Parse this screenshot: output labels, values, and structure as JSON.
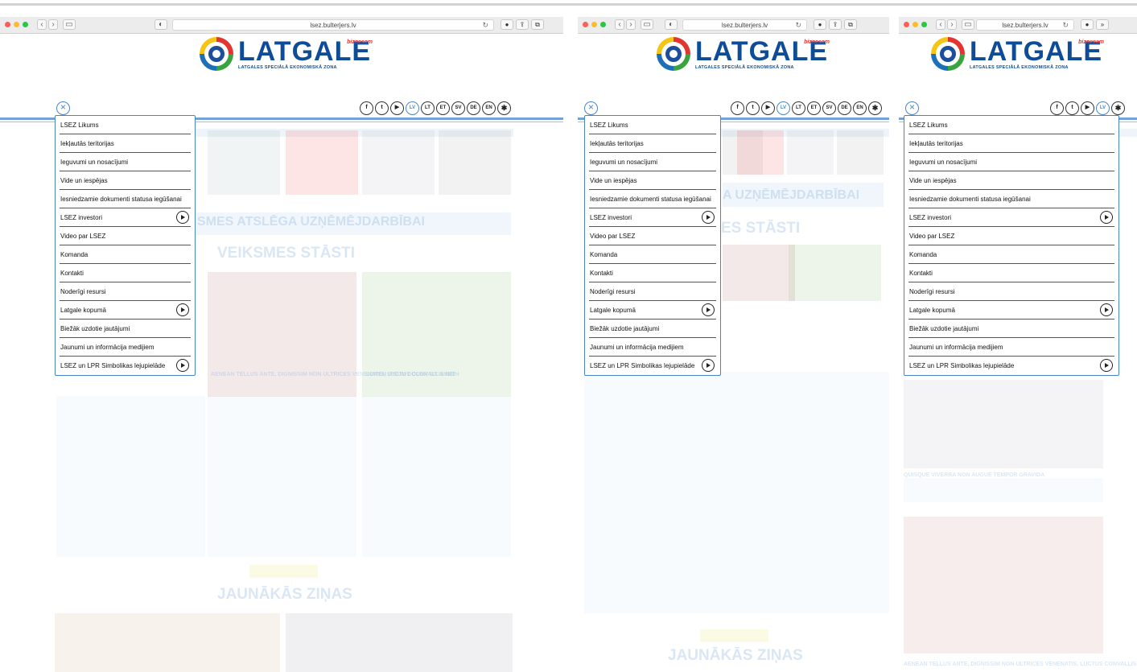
{
  "url": "lsez.bulterjers.lv",
  "logo": {
    "word": "LATGALE",
    "subtitle": "LATGALES SPECIĀLĀ EKONOMISKĀ ZONA",
    "tag": "biznesam"
  },
  "socials": [
    "f",
    "t",
    "▶"
  ],
  "languages": [
    "LV",
    "LT",
    "ET",
    "SV",
    "DE",
    "EN"
  ],
  "active_language": "LV",
  "menu": [
    {
      "label": "LSEZ Likums",
      "arrow": false
    },
    {
      "label": "Iekļautās teritorijas",
      "arrow": false
    },
    {
      "label": "Ieguvumi un nosacījumi",
      "arrow": false
    },
    {
      "label": "Vide un iespējas",
      "arrow": false
    },
    {
      "label": "Iesniedzamie dokumenti statusa iegūšanai",
      "arrow": false
    },
    {
      "label": "LSEZ investori",
      "arrow": true
    },
    {
      "label": "Video par LSEZ",
      "arrow": false
    },
    {
      "label": "Komanda",
      "arrow": false
    },
    {
      "label": "Kontakti",
      "arrow": false
    },
    {
      "label": "Noderīgi resursi",
      "arrow": false
    },
    {
      "label": "Latgale kopumā",
      "arrow": true
    },
    {
      "label": "Biežāk uzdotie jautājumi",
      "arrow": false
    },
    {
      "label": "Jaunumi un informācija medijiem",
      "arrow": false
    },
    {
      "label": "LSEZ un LPR Simbolikas lejupielāde",
      "arrow": true
    }
  ],
  "background": {
    "heading1": "VEIKSMES STĀSTI",
    "heading2": "JAUNĀKĀS ZIŅAS",
    "banner": "SMES ATSLĒGA UZŅĒMĒJDARBĪBAI",
    "banner_short": "A UZŅĒMĒJDARBĪBAI",
    "heading1_short": "ES STĀSTI",
    "card1": "AENEAN TELLUS ANTE, DIGNISSIM NON ULTRICES VENENATIS, LUCTUS CONVALLIS NIBH",
    "card2": "LOREM IPSUM DOLOR SIT AMET",
    "card3": "QUISQUE VIVERRA NON AUGUE TEMPOR GRAVIDA"
  }
}
